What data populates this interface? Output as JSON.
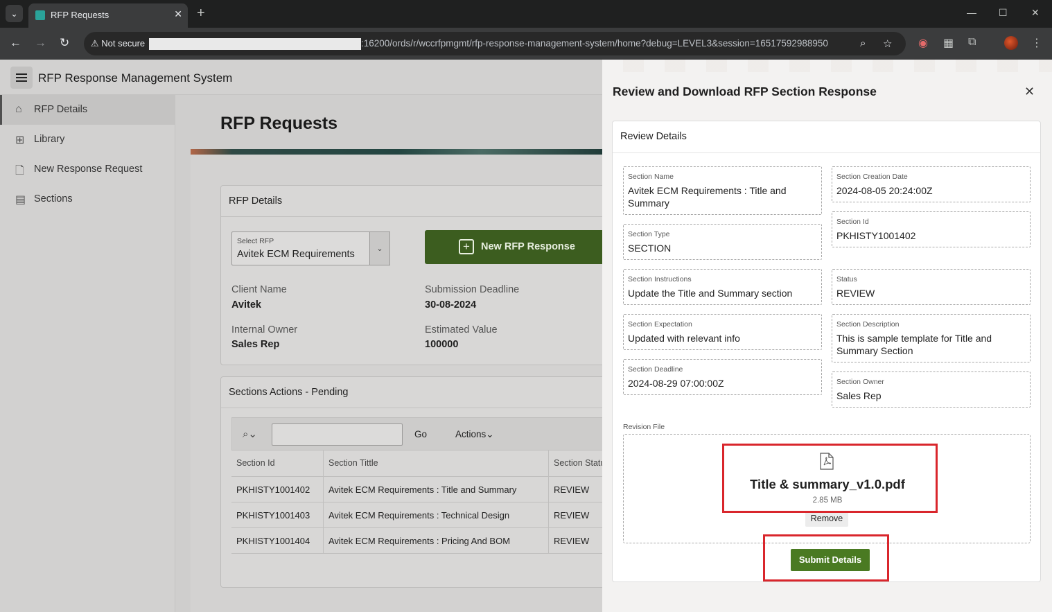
{
  "browser": {
    "tab_title": "RFP Requests",
    "not_secure": "Not secure",
    "url": ":16200/ords/r/wccrfpmgmt/rfp-response-management-system/home?debug=LEVEL3&session=16517592988950"
  },
  "app": {
    "title": "RFP Response Management System"
  },
  "sidebar": {
    "items": [
      {
        "label": "RFP Details",
        "icon": "home-icon"
      },
      {
        "label": "Library",
        "icon": "library-icon"
      },
      {
        "label": "New Response Request",
        "icon": "new-document-icon"
      },
      {
        "label": "Sections",
        "icon": "table-icon"
      }
    ]
  },
  "main": {
    "page_title": "RFP Requests",
    "rfp_details": {
      "title": "RFP Details",
      "select_label": "Select RFP",
      "select_value": "Avitek ECM Requirements",
      "new_button": "New RFP Response",
      "client_name_label": "Client Name",
      "client_name": "Avitek",
      "deadline_label": "Submission Deadline",
      "deadline": "30-08-2024",
      "owner_label": "Internal Owner",
      "owner": "Sales Rep",
      "value_label": "Estimated Value",
      "value": "100000"
    },
    "sections": {
      "title": "Sections Actions - Pending",
      "go": "Go",
      "actions": "Actions",
      "columns": [
        "Section Id",
        "Section Tittle",
        "Section Status"
      ],
      "rows": [
        [
          "PKHISTY1001402",
          "Avitek ECM Requirements : Title and Summary",
          "REVIEW"
        ],
        [
          "PKHISTY1001403",
          "Avitek ECM Requirements : Technical Design",
          "REVIEW"
        ],
        [
          "PKHISTY1001404",
          "Avitek ECM Requirements : Pricing And BOM",
          "REVIEW"
        ]
      ]
    }
  },
  "drawer": {
    "title": "Review and Download RFP Section Response",
    "region_title": "Review Details",
    "fields": {
      "section_name_label": "Section Name",
      "section_name": "Avitek ECM Requirements : Title and Summary",
      "section_type_label": "Section Type",
      "section_type": "SECTION",
      "instructions_label": "Section Instructions",
      "instructions": "Update the Title and Summary section",
      "expectation_label": "Section Expectation",
      "expectation": "Updated with relevant info",
      "deadline_label": "Section Deadline",
      "deadline": "2024-08-29 07:00:00Z",
      "creation_label": "Section Creation Date",
      "creation": "2024-08-05 20:24:00Z",
      "id_label": "Section Id",
      "id": "PKHISTY1001402",
      "status_label": "Status",
      "status": "REVIEW",
      "description_label": "Section Description",
      "description": "This is sample template for Title and Summary Section",
      "owner_label": "Section Owner",
      "owner": "Sales Rep"
    },
    "revision_label": "Revision File",
    "file_name": "Title & summary_v1.0.pdf",
    "file_size": "2.85 MB",
    "remove": "Remove",
    "submit": "Submit Details"
  },
  "colors": {
    "accent_green": "#4a7a22",
    "highlight_red": "#d9262c"
  }
}
